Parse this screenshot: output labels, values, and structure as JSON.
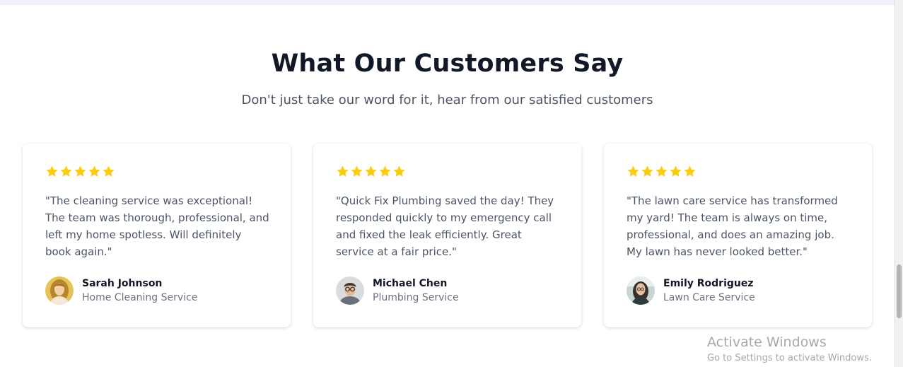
{
  "section": {
    "title": "What Our Customers Say",
    "subtitle": "Don't just take our word for it, hear from our satisfied customers"
  },
  "colors": {
    "star": "#facc15",
    "heading": "#111827",
    "body_text": "#4b5563"
  },
  "testimonials": [
    {
      "rating": 5,
      "quote": "\"The cleaning service was exceptional! The team was thorough, professional, and left my home spotless. Will definitely book again.\"",
      "name": "Sarah Johnson",
      "service": "Home Cleaning Service",
      "avatar_icon": "woman-avatar"
    },
    {
      "rating": 5,
      "quote": "\"Quick Fix Plumbing saved the day! They responded quickly to my emergency call and fixed the leak efficiently. Great service at a fair price.\"",
      "name": "Michael Chen",
      "service": "Plumbing Service",
      "avatar_icon": "man-with-glasses-avatar"
    },
    {
      "rating": 5,
      "quote": "\"The lawn care service has transformed my yard! The team is always on time, professional, and does an amazing job. My lawn has never looked better.\"",
      "name": "Emily Rodriguez",
      "service": "Lawn Care Service",
      "avatar_icon": "woman-avatar"
    }
  ],
  "windows_watermark": {
    "title": "Activate Windows",
    "subtitle": "Go to Settings to activate Windows."
  }
}
